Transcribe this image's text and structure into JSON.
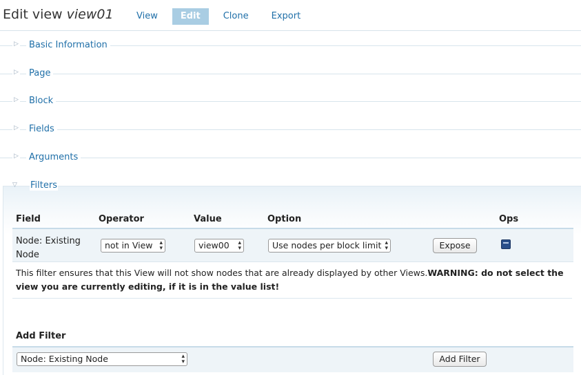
{
  "header": {
    "title_prefix": "Edit view",
    "title_view_name": "view01",
    "tabs": [
      {
        "label": "View",
        "active": false
      },
      {
        "label": "Edit",
        "active": true
      },
      {
        "label": "Clone",
        "active": false
      },
      {
        "label": "Export",
        "active": false
      }
    ]
  },
  "sections": [
    {
      "label": "Basic Information",
      "expanded": false
    },
    {
      "label": "Page",
      "expanded": false
    },
    {
      "label": "Block",
      "expanded": false
    },
    {
      "label": "Fields",
      "expanded": false
    },
    {
      "label": "Arguments",
      "expanded": false
    }
  ],
  "filters": {
    "label": "Filters",
    "expanded": true,
    "columns": [
      "Field",
      "Operator",
      "Value",
      "Option",
      "Ops"
    ],
    "row": {
      "field": "Node: Existing Node",
      "operator": "not in View",
      "value": "view00",
      "option": "Use nodes per block limit",
      "expose_label": "Expose"
    },
    "description_normal": "This filter ensures that this View will not show nodes that are already displayed by other Views.",
    "description_warning": "WARNING: do not select the view you are currently editing, if it is in the value list!",
    "add_filter_label": "Add Filter",
    "add_filter_select": "Node: Existing Node",
    "add_filter_button": "Add Filter"
  },
  "icons": {
    "collapsed": "triangle-right-icon",
    "expanded": "triangle-down-icon",
    "ops": "delete-icon"
  },
  "colors": {
    "link": "#1f6fa8",
    "active_tab_bg": "#a9cde3",
    "row_bg": "#eef4f8"
  }
}
